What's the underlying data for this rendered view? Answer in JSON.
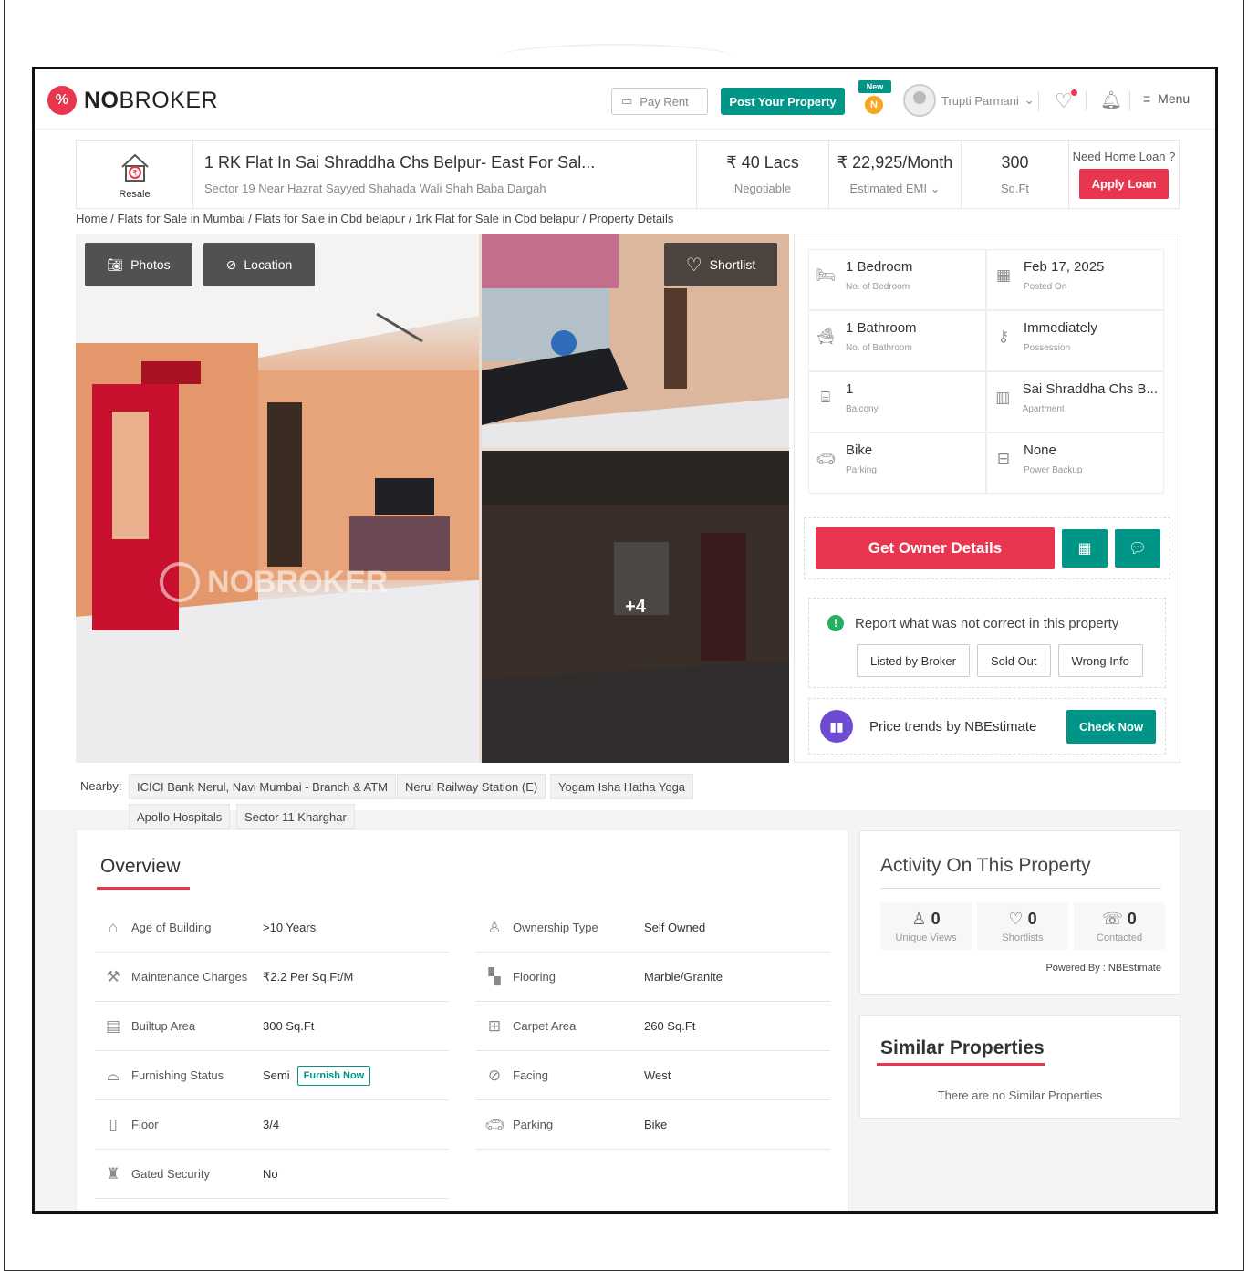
{
  "header": {
    "brand_prefix": "NO",
    "brand_suffix": "BROKER",
    "pay_rent": "Pay Rent",
    "post_property": "Post Your Property",
    "new_badge": "New",
    "coin_letter": "N",
    "user_name": "Trupti Parmani",
    "menu_label": "Menu"
  },
  "summary": {
    "tag": "Resale",
    "title": "1 RK Flat In Sai Shraddha Chs Belpur- East For Sal...",
    "address": "Sector 19 Near Hazrat Sayyed Shahada Wali Shah Baba Dargah",
    "price": "₹ 40 Lacs",
    "price_note": "Negotiable",
    "emi": "₹ 22,925/Month",
    "emi_note": "Estimated EMI",
    "area": "300",
    "area_unit": "Sq.Ft",
    "loan_question": "Need Home Loan ?",
    "apply_loan": "Apply Loan"
  },
  "breadcrumb": "Home / Flats for Sale in Mumbai / Flats for Sale in Cbd belapur / 1rk Flat for Sale in Cbd belapur / Property Details",
  "gallery": {
    "photos": "Photos",
    "location": "Location",
    "shortlist": "Shortlist",
    "more_count": "+4",
    "watermark": "NOBROKER"
  },
  "facts": [
    {
      "value": "1 Bedroom",
      "label": "No. of Bedroom",
      "icon": "bed-icon"
    },
    {
      "value": "Feb 17, 2025",
      "label": "Posted On",
      "icon": "calendar-icon"
    },
    {
      "value": "1 Bathroom",
      "label": "No. of Bathroom",
      "icon": "bath-icon"
    },
    {
      "value": "Immediately",
      "label": "Possession",
      "icon": "key-icon"
    },
    {
      "value": "1",
      "label": "Balcony",
      "icon": "balcony-icon"
    },
    {
      "value": "Sai Shraddha Chs B...",
      "label": "Apartment",
      "icon": "building-icon"
    },
    {
      "value": "Bike",
      "label": "Parking",
      "icon": "car-icon"
    },
    {
      "value": "None",
      "label": "Power Backup",
      "icon": "battery-icon"
    }
  ],
  "actions": {
    "owner_details": "Get Owner Details"
  },
  "report": {
    "heading": "Report what was not correct in this property",
    "options": [
      "Listed by Broker",
      "Sold Out",
      "Wrong Info"
    ]
  },
  "trend": {
    "label": "Price trends by NBEstimate",
    "button": "Check Now"
  },
  "nearby": {
    "label": "Nearby:",
    "places": [
      "ICICI Bank Nerul, Navi Mumbai - Branch & ATM",
      "Nerul Railway Station (E)",
      "Yogam Isha Hatha Yoga",
      "Apollo Hospitals",
      "Sector 11 Kharghar"
    ]
  },
  "overview": {
    "title": "Overview",
    "left": [
      {
        "key": "Age of Building",
        "value": ">10 Years"
      },
      {
        "key": "Maintenance Charges",
        "value": "₹2.2 Per Sq.Ft/M"
      },
      {
        "key": "Builtup Area",
        "value": "300 Sq.Ft"
      },
      {
        "key": "Furnishing Status",
        "value": "Semi"
      },
      {
        "key": "Floor",
        "value": "3/4"
      },
      {
        "key": "Gated Security",
        "value": "No"
      }
    ],
    "right": [
      {
        "key": "Ownership Type",
        "value": "Self Owned"
      },
      {
        "key": "Flooring",
        "value": "Marble/Granite"
      },
      {
        "key": "Carpet Area",
        "value": "260 Sq.Ft"
      },
      {
        "key": "Facing",
        "value": "West"
      },
      {
        "key": "Parking",
        "value": "Bike"
      }
    ],
    "furnish_now": "Furnish Now"
  },
  "activity": {
    "title": "Activity On This Property",
    "stats": [
      {
        "count": "0",
        "label": "Unique Views"
      },
      {
        "count": "0",
        "label": "Shortlists"
      },
      {
        "count": "0",
        "label": "Contacted"
      }
    ],
    "powered_by": "Powered By : NBEstimate"
  },
  "similar": {
    "title": "Similar Properties",
    "empty": "There are no Similar Properties"
  },
  "colors": {
    "brand_red": "#e8364f",
    "brand_green": "#009587"
  }
}
